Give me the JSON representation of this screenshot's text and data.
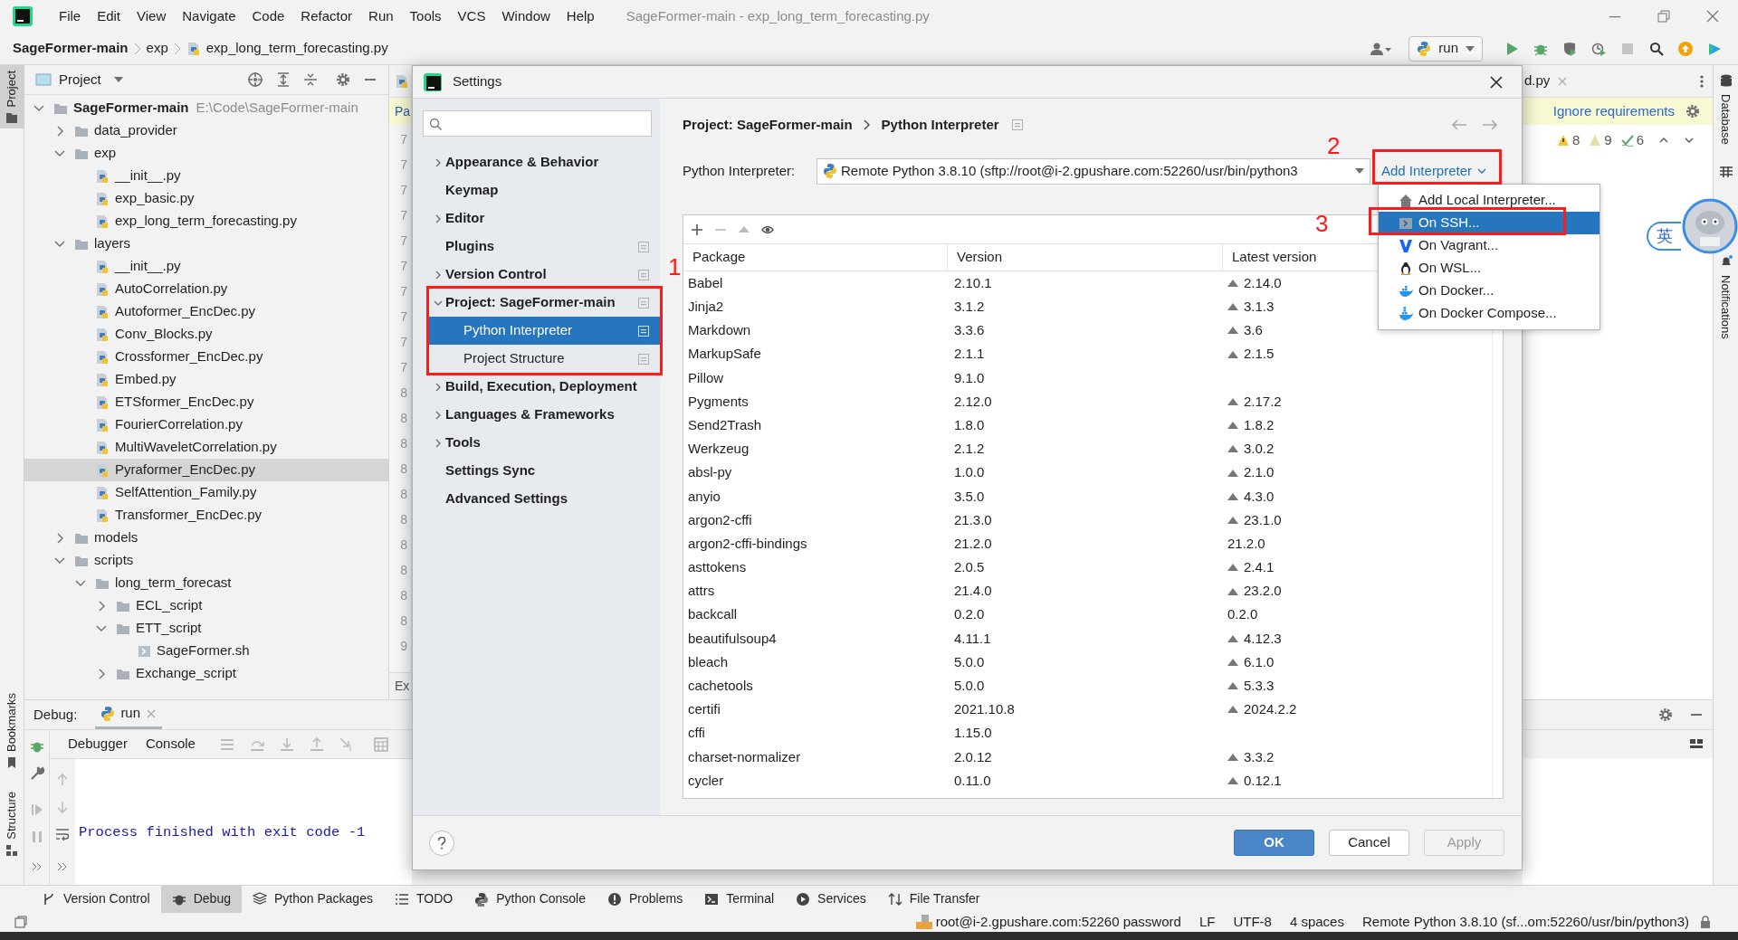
{
  "window": {
    "title": "SageFormer-main - exp_long_term_forecasting.py"
  },
  "menu": [
    "File",
    "Edit",
    "View",
    "Navigate",
    "Code",
    "Refactor",
    "Run",
    "Tools",
    "VCS",
    "Window",
    "Help"
  ],
  "breadcrumb": [
    "SageFormer-main",
    "exp",
    "exp_long_term_forecasting.py"
  ],
  "run_config": {
    "label": "run"
  },
  "left_stripe": [
    {
      "label": "Project",
      "selected": true
    },
    {
      "label": "Bookmarks",
      "selected": false
    },
    {
      "label": "Structure",
      "selected": false
    }
  ],
  "right_stripe": [
    {
      "label": "Database"
    },
    {
      "label": "Notifications"
    }
  ],
  "project_panel": {
    "title": "Project",
    "tree": [
      {
        "label": "SageFormer-main",
        "kind": "folder",
        "hint": "E:\\Code\\SageFormer-main",
        "expanded": true,
        "selected": false,
        "children": [
          {
            "label": "data_provider",
            "kind": "folder",
            "expanded": false,
            "selected": false
          },
          {
            "label": "exp",
            "kind": "folder",
            "expanded": true,
            "selected": false,
            "children": [
              {
                "label": "__init__.py",
                "kind": "py",
                "selected": false
              },
              {
                "label": "exp_basic.py",
                "kind": "py",
                "selected": false
              },
              {
                "label": "exp_long_term_forecasting.py",
                "kind": "py",
                "selected": false
              }
            ]
          },
          {
            "label": "layers",
            "kind": "folder",
            "expanded": true,
            "selected": false,
            "children": [
              {
                "label": "__init__.py",
                "kind": "py",
                "selected": false
              },
              {
                "label": "AutoCorrelation.py",
                "kind": "py",
                "selected": false
              },
              {
                "label": "Autoformer_EncDec.py",
                "kind": "py",
                "selected": false
              },
              {
                "label": "Conv_Blocks.py",
                "kind": "py",
                "selected": false
              },
              {
                "label": "Crossformer_EncDec.py",
                "kind": "py",
                "selected": false
              },
              {
                "label": "Embed.py",
                "kind": "py",
                "selected": false
              },
              {
                "label": "ETSformer_EncDec.py",
                "kind": "py",
                "selected": false
              },
              {
                "label": "FourierCorrelation.py",
                "kind": "py",
                "selected": false
              },
              {
                "label": "MultiWaveletCorrelation.py",
                "kind": "py",
                "selected": false
              },
              {
                "label": "Pyraformer_EncDec.py",
                "kind": "py",
                "selected": true
              },
              {
                "label": "SelfAttention_Family.py",
                "kind": "py",
                "selected": false
              },
              {
                "label": "Transformer_EncDec.py",
                "kind": "py",
                "selected": false
              }
            ]
          },
          {
            "label": "models",
            "kind": "folder",
            "expanded": false,
            "selected": false
          },
          {
            "label": "scripts",
            "kind": "folder",
            "expanded": true,
            "selected": false,
            "children": [
              {
                "label": "long_term_forecast",
                "kind": "folder",
                "expanded": true,
                "selected": false,
                "children": [
                  {
                    "label": "ECL_script",
                    "kind": "folder",
                    "expanded": false,
                    "selected": false
                  },
                  {
                    "label": "ETT_script",
                    "kind": "folder",
                    "expanded": true,
                    "selected": false,
                    "children": [
                      {
                        "label": "SageFormer.sh",
                        "kind": "sh",
                        "selected": false
                      }
                    ]
                  },
                  {
                    "label": "Exchange_script",
                    "kind": "folder",
                    "expanded": false,
                    "selected": false
                  }
                ]
              }
            ]
          }
        ]
      }
    ]
  },
  "editor": {
    "tab": "d.py",
    "banner_left": "Pa",
    "banner_right": "Ignore requirements",
    "gutter": [
      "7",
      "7",
      "7",
      "7",
      "7",
      "7",
      "7",
      "7",
      "7",
      "7",
      "8",
      "8",
      "8",
      "8",
      "8",
      "8",
      "8",
      "8",
      "8",
      "8",
      "9"
    ],
    "footer_left": "Ex",
    "inspections": [
      {
        "count": "8",
        "kind": "warning"
      },
      {
        "count": "9",
        "kind": "weak"
      },
      {
        "count": "6",
        "kind": "typo"
      }
    ]
  },
  "debug": {
    "title": "Debug:",
    "tab": "run",
    "subtabs": [
      "Debugger",
      "Console"
    ],
    "console": "Process finished with exit code -1"
  },
  "tool_tabs": [
    {
      "label": "Version Control",
      "kind": "vcs",
      "selected": false
    },
    {
      "label": "Debug",
      "kind": "debug",
      "selected": true
    },
    {
      "label": "Python Packages",
      "kind": "packages",
      "selected": false
    },
    {
      "label": "TODO",
      "kind": "todo",
      "selected": false
    },
    {
      "label": "Python Console",
      "kind": "console",
      "selected": false
    },
    {
      "label": "Problems",
      "kind": "problems",
      "selected": false
    },
    {
      "label": "Terminal",
      "kind": "terminal",
      "selected": false
    },
    {
      "label": "Services",
      "kind": "services",
      "selected": false
    },
    {
      "label": "File Transfer",
      "kind": "transfer",
      "selected": false
    }
  ],
  "status_bar": [
    "root@i-2.gpushare.com:52260 password",
    "LF",
    "UTF-8",
    "4 spaces",
    "Remote Python 3.8.10 (sf...om:52260/usr/bin/python3)"
  ],
  "ime": {
    "label": "英"
  },
  "settings_dialog": {
    "title": "Settings",
    "nav": [
      {
        "label": "Appearance & Behavior",
        "expanded": false,
        "selected": false,
        "project_scope": false
      },
      {
        "label": "Keymap",
        "selected": false,
        "project_scope": false
      },
      {
        "label": "Editor",
        "expanded": false,
        "selected": false,
        "project_scope": false
      },
      {
        "label": "Plugins",
        "selected": false,
        "project_scope": true
      },
      {
        "label": "Version Control",
        "expanded": false,
        "selected": false,
        "project_scope": true
      },
      {
        "label": "Project: SageFormer-main",
        "expanded": true,
        "selected": false,
        "project_scope": true,
        "children": [
          {
            "label": "Python Interpreter",
            "selected": true,
            "project_scope": true
          },
          {
            "label": "Project Structure",
            "selected": false,
            "project_scope": true
          }
        ]
      },
      {
        "label": "Build, Execution, Deployment",
        "expanded": false,
        "selected": false,
        "project_scope": false
      },
      {
        "label": "Languages & Frameworks",
        "expanded": false,
        "selected": false,
        "project_scope": false
      },
      {
        "label": "Tools",
        "expanded": false,
        "selected": false,
        "project_scope": false
      },
      {
        "label": "Settings Sync",
        "selected": false,
        "project_scope": false
      },
      {
        "label": "Advanced Settings",
        "selected": false,
        "project_scope": false
      }
    ],
    "breadcrumb": [
      "Project: SageFormer-main",
      "Python Interpreter"
    ],
    "interpreter": {
      "label": "Python Interpreter:",
      "value": "Remote Python 3.8.10 (sftp://root@i-2.gpushare.com:52260/usr/bin/python3"
    },
    "add_button": "Add Interpreter",
    "add_menu": [
      {
        "label": "Add Local Interpreter...",
        "kind": "local",
        "selected": false
      },
      {
        "label": "On SSH...",
        "kind": "ssh",
        "selected": true
      },
      {
        "label": "On Vagrant...",
        "kind": "vagrant",
        "selected": false
      },
      {
        "label": "On WSL...",
        "kind": "wsl",
        "selected": false
      },
      {
        "label": "On Docker...",
        "kind": "docker",
        "selected": false
      },
      {
        "label": "On Docker Compose...",
        "kind": "compose",
        "selected": false
      }
    ],
    "packages": {
      "columns": [
        "Package",
        "Version",
        "Latest version"
      ],
      "rows": [
        {
          "name": "Babel",
          "version": "2.10.1",
          "latest": "2.14.0",
          "upgrade": true
        },
        {
          "name": "Jinja2",
          "version": "3.1.2",
          "latest": "3.1.3",
          "upgrade": true
        },
        {
          "name": "Markdown",
          "version": "3.3.6",
          "latest": "3.6",
          "upgrade": true
        },
        {
          "name": "MarkupSafe",
          "version": "2.1.1",
          "latest": "2.1.5",
          "upgrade": true
        },
        {
          "name": "Pillow",
          "version": "9.1.0",
          "upgrade": false
        },
        {
          "name": "Pygments",
          "version": "2.12.0",
          "latest": "2.17.2",
          "upgrade": true
        },
        {
          "name": "Send2Trash",
          "version": "1.8.0",
          "latest": "1.8.2",
          "upgrade": true
        },
        {
          "name": "Werkzeug",
          "version": "2.1.2",
          "latest": "3.0.2",
          "upgrade": true
        },
        {
          "name": "absl-py",
          "version": "1.0.0",
          "latest": "2.1.0",
          "upgrade": true
        },
        {
          "name": "anyio",
          "version": "3.5.0",
          "latest": "4.3.0",
          "upgrade": true
        },
        {
          "name": "argon2-cffi",
          "version": "21.3.0",
          "latest": "23.1.0",
          "upgrade": true
        },
        {
          "name": "argon2-cffi-bindings",
          "version": "21.2.0",
          "latest": "21.2.0",
          "upgrade": false
        },
        {
          "name": "asttokens",
          "version": "2.0.5",
          "latest": "2.4.1",
          "upgrade": true
        },
        {
          "name": "attrs",
          "version": "21.4.0",
          "latest": "23.2.0",
          "upgrade": true
        },
        {
          "name": "backcall",
          "version": "0.2.0",
          "latest": "0.2.0",
          "upgrade": false
        },
        {
          "name": "beautifulsoup4",
          "version": "4.11.1",
          "latest": "4.12.3",
          "upgrade": true
        },
        {
          "name": "bleach",
          "version": "5.0.0",
          "latest": "6.1.0",
          "upgrade": true
        },
        {
          "name": "cachetools",
          "version": "5.0.0",
          "latest": "5.3.3",
          "upgrade": true
        },
        {
          "name": "certifi",
          "version": "2021.10.8",
          "latest": "2024.2.2",
          "upgrade": true
        },
        {
          "name": "cffi",
          "version": "1.15.0",
          "upgrade": false
        },
        {
          "name": "charset-normalizer",
          "version": "2.0.12",
          "latest": "3.3.2",
          "upgrade": true
        },
        {
          "name": "cycler",
          "version": "0.11.0",
          "latest": "0.12.1",
          "upgrade": true
        }
      ]
    },
    "buttons": [
      {
        "label": "OK",
        "kind": "primary",
        "disabled": false
      },
      {
        "label": "Cancel",
        "kind": "default",
        "disabled": false
      },
      {
        "label": "Apply",
        "kind": "default",
        "disabled": true
      }
    ],
    "annotations": [
      {
        "label": "1"
      },
      {
        "label": "2"
      },
      {
        "label": "3"
      }
    ]
  }
}
